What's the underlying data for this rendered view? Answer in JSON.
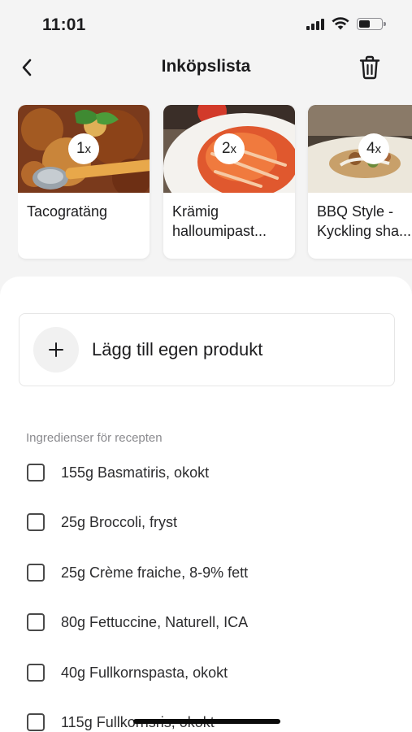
{
  "status_bar": {
    "time": "11:01",
    "battery_level": 0.55
  },
  "nav": {
    "title": "Inköpslista",
    "back_icon": "chevron-left-icon",
    "trash_icon": "trash-icon"
  },
  "recipes": [
    {
      "title": "Tacogratäng",
      "quantity": "1x"
    },
    {
      "title": "Krämig halloumipast...",
      "quantity": "2x"
    },
    {
      "title": "BBQ Style - Kyckling sha...",
      "quantity": "4x"
    }
  ],
  "add_product": {
    "label": "Lägg till egen produkt",
    "icon": "plus-icon"
  },
  "ingredients_section": {
    "label": "Ingredienser för recepten",
    "items": [
      {
        "text": "155g Basmatiris, okokt",
        "checked": false
      },
      {
        "text": "25g Broccoli, fryst",
        "checked": false
      },
      {
        "text": "25g Crème fraiche, 8-9% fett",
        "checked": false
      },
      {
        "text": "80g Fettuccine, Naturell, ICA",
        "checked": false
      },
      {
        "text": "40g Fullkornspasta, okokt",
        "checked": false
      },
      {
        "text": "115g Fullkornsris, okokt",
        "checked": false
      }
    ]
  },
  "colors": {
    "background": "#f4f4f4",
    "sheet": "#ffffff",
    "text": "#1c1c1e",
    "muted": "#8a8a8e"
  }
}
